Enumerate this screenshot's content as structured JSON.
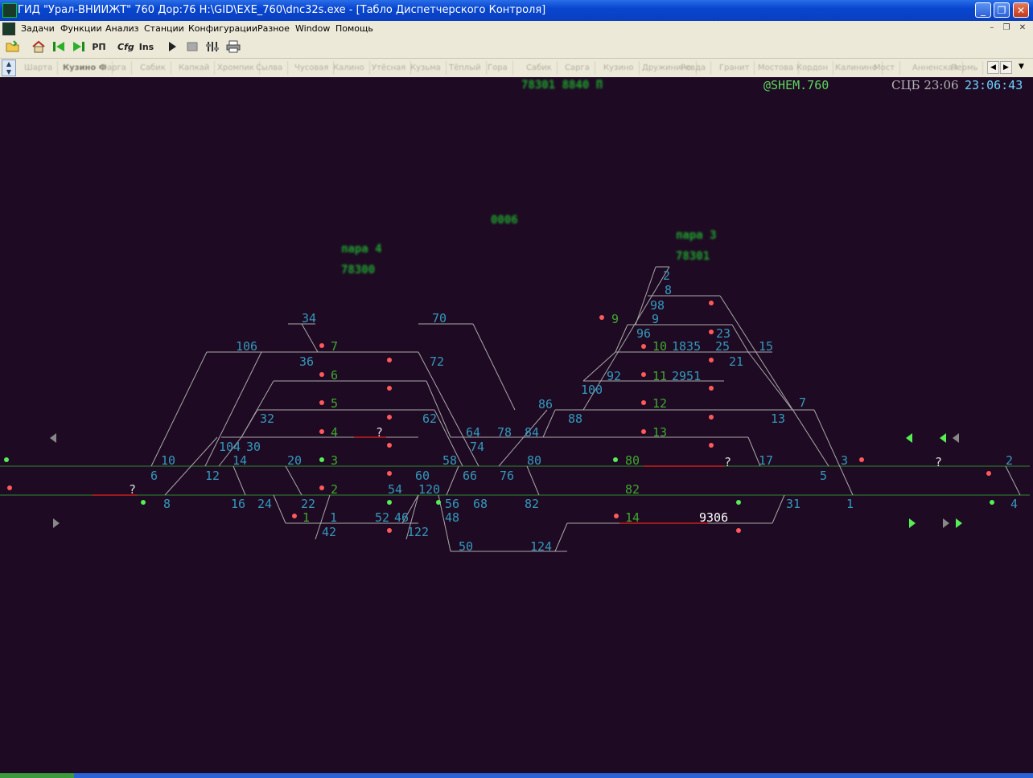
{
  "window": {
    "title": "ГИД \"Урал-ВНИИЖТ\" 760 Дор:76 H:\\GID\\EXE_760\\dnc32s.exe - [Табло Диспетчерского Контроля]",
    "minimize": "_",
    "maximize": "❐",
    "close": "✕"
  },
  "menu": {
    "items": [
      "Задачи",
      "Функции",
      "Анализ",
      "Станции",
      "Конфигурации",
      "Разное",
      "Window",
      "Помощь"
    ],
    "mdi_min": "–",
    "mdi_restore": "❐",
    "mdi_close": "✕"
  },
  "toolbar": {
    "open_icon": "folder-open-icon",
    "home_icon": "home-icon",
    "first_icon": "skip-back-icon",
    "last_icon": "skip-forward-icon",
    "rp": "РП",
    "cfg": "Cfg",
    "ins": "Ins",
    "play_icon": "play-icon",
    "stop_icon": "stop-icon",
    "tools_icon": "tools-icon",
    "print_icon": "print-icon"
  },
  "tabs": {
    "items": [
      "Шарта",
      "Кузино Ф",
      "Сарга",
      "Сабик",
      "Капкай",
      "Хромпик",
      "Сылва",
      "Чусовая",
      "Калино",
      "Утёсная",
      "Кузьма",
      "Тёплый",
      "Гора",
      "Сабик",
      "Сарга",
      "Кузино",
      "Дружинино",
      "Ревда",
      "Гранит",
      "Мостова",
      "Кордон",
      "Калинино",
      "Мост",
      "Анненская",
      "Пермь"
    ],
    "active_index": 1
  },
  "status": {
    "train_label": "78301 8840 П",
    "scheme": "@SHEM.760",
    "time_label": "СЦБ 23:06",
    "clock": "23:06:43"
  },
  "overlays": {
    "center": "0006",
    "left_line1": "пара 4",
    "left_line2": "78300",
    "right_line1": "пара 3",
    "right_line2": "78301"
  },
  "colors": {
    "background": "#1e0a23",
    "track": "#a9a9a9",
    "track_main": "#2c8a2c",
    "occupied": "#9b1b1b",
    "switch_number": "#3399bb",
    "route_number": "#3fa82e",
    "signal_red": "#ff5a5a",
    "signal_green": "#55ee55",
    "clock": "#6dd3ff",
    "scheme_text": "#5fd65f"
  },
  "schema": {
    "switch_labels": [
      "34",
      "70",
      "106",
      "36",
      "72",
      "32",
      "62",
      "104",
      "30",
      "64",
      "74",
      "78",
      "84",
      "86",
      "88",
      "100",
      "92",
      "96",
      "98",
      "2",
      "8",
      "9",
      "23",
      "25",
      "1835",
      "2951",
      "21",
      "15",
      "7",
      "13",
      "10",
      "14",
      "20",
      "58",
      "80",
      "17",
      "3",
      "2",
      "6",
      "12",
      "60",
      "66",
      "76",
      "5",
      "8",
      "16",
      "24",
      "22",
      "54",
      "120",
      "56",
      "68",
      "82",
      "31",
      "1",
      "4",
      "1",
      "52",
      "46",
      "48",
      "42",
      "122",
      "50",
      "124",
      "9306"
    ],
    "track_labels": [
      "7",
      "6",
      "5",
      "4",
      "3",
      "2",
      "1",
      "9",
      "10",
      "11",
      "12",
      "13",
      "80",
      "82",
      "14"
    ],
    "unknown_marks": [
      "?",
      "?",
      "?",
      "?",
      "?"
    ]
  }
}
